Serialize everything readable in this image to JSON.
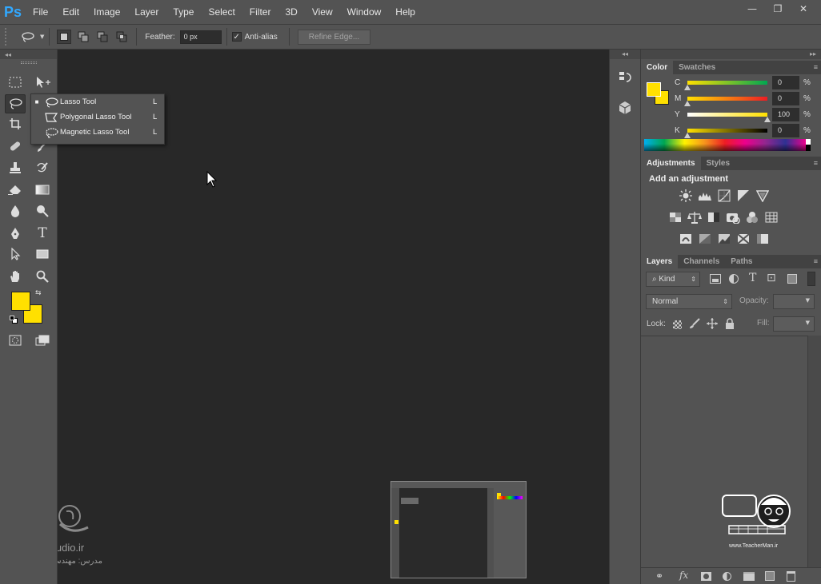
{
  "app": {
    "logo": "Ps"
  },
  "menu": [
    "File",
    "Edit",
    "Image",
    "Layer",
    "Type",
    "Select",
    "Filter",
    "3D",
    "View",
    "Window",
    "Help"
  ],
  "window_controls": {
    "minimize": "—",
    "restore": "❐",
    "close": "✕"
  },
  "options": {
    "feather_label": "Feather:",
    "feather_value": "0 px",
    "antialias_label": "Anti-alias",
    "antialias_checked": "✓",
    "refine_edge_label": "Refine Edge..."
  },
  "flyout": {
    "items": [
      {
        "label": "Lasso Tool",
        "key": "L",
        "bullet": "■"
      },
      {
        "label": "Polygonal Lasso Tool",
        "key": "L",
        "bullet": ""
      },
      {
        "label": "Magnetic Lasso Tool",
        "key": "L",
        "bullet": ""
      }
    ]
  },
  "colors": {
    "foreground": "#ffe000",
    "background": "#ffe000",
    "accent": "#31a8ff"
  },
  "color_panel": {
    "tabs": [
      "Color",
      "Swatches"
    ],
    "channels": [
      {
        "label": "C",
        "value": "0",
        "unit": "%"
      },
      {
        "label": "M",
        "value": "0",
        "unit": "%"
      },
      {
        "label": "Y",
        "value": "100",
        "unit": "%"
      },
      {
        "label": "K",
        "value": "0",
        "unit": "%"
      }
    ]
  },
  "adjustments_panel": {
    "tabs": [
      "Adjustments",
      "Styles"
    ],
    "heading": "Add an adjustment"
  },
  "layers_panel": {
    "tabs": [
      "Layers",
      "Channels",
      "Paths"
    ],
    "kind_label": "Kind",
    "blend_mode": "Normal",
    "opacity_label": "Opacity:",
    "lock_label": "Lock:",
    "fill_label": "Fill:",
    "filter_icons": [
      "T",
      "⊡"
    ]
  },
  "tools": {
    "type_tool": "T"
  },
  "watermarks": {
    "left_site": "safaStudio.ir",
    "left_sub": "مدرس: مهندس فدائی",
    "right_site": "www.TeacherMan.ir"
  }
}
